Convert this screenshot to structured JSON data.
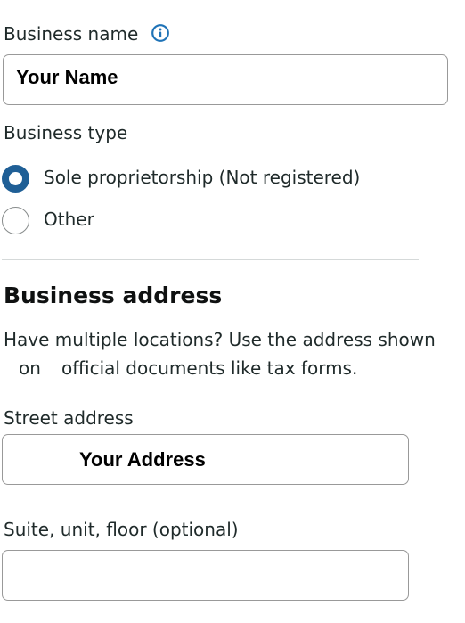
{
  "form": {
    "business_name": {
      "label": "Business name",
      "info_icon": "info-icon",
      "value": "Your Name"
    },
    "business_type": {
      "label": "Business type",
      "options": [
        {
          "label": "Sole proprietorship (Not registered)",
          "selected": true
        },
        {
          "label": "Other",
          "selected": false
        }
      ]
    },
    "business_address": {
      "title": "Business address",
      "helper_line_1": "Have multiple locations? Use the address shown",
      "helper_word": "on",
      "helper_line_2": "official documents like tax forms.",
      "street": {
        "label": "Street address",
        "value": "Your Address"
      },
      "suite": {
        "label": "Suite, unit, floor (optional)",
        "value": ""
      }
    }
  },
  "colors": {
    "accent": "#1f5f96",
    "info_icon": "#1f73b7",
    "border": "#999999",
    "text": "#1f2a2a"
  }
}
